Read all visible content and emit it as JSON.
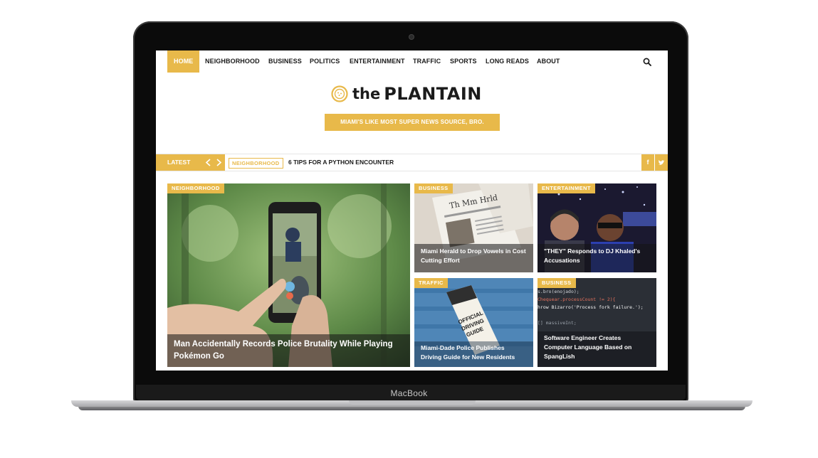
{
  "device": {
    "brand_label": "MacBook"
  },
  "nav": {
    "items": [
      "HOME",
      "NEIGHBORHOOD",
      "BUSINESS",
      "POLITICS",
      "ENTERTAINMENT",
      "TRAFFIC",
      "SPORTS",
      "LONG READS",
      "ABOUT"
    ],
    "active": "HOME",
    "search_icon": "search-icon"
  },
  "masthead": {
    "logo_prefix": "the",
    "logo_name": "PLANTAIN",
    "tagline": "MIAMI'S LIKE MOST SUPER NEWS SOURCE, BRO."
  },
  "ticker": {
    "label": "LATEST",
    "category": "NEIGHBORHOOD",
    "headline": "6 TIPS FOR A PYTHON ENCOUNTER",
    "social": [
      "f",
      "twitter-icon"
    ]
  },
  "articles": [
    {
      "category": "NEIGHBORHOOD",
      "title": "Man Accidentally Records Police Brutality While Playing Pokémon Go"
    },
    {
      "category": "BUSINESS",
      "title": "Miami Herald to Drop Vowels in Cost Cutting Effort"
    },
    {
      "category": "ENTERTAINMENT",
      "title": "\"THEY\" Responds to DJ Khaled's Accusations"
    },
    {
      "category": "TRAFFIC",
      "title": "Miami-Dade Police Publishes Driving Guide for New Residents"
    },
    {
      "category": "BUSINESS",
      "title": "Software Engineer Creates Computer Language Based on SpangLish"
    }
  ],
  "image_text": {
    "newspaper_masthead": "Th Mm Hrld",
    "guide_line1": "OFFICIAL",
    "guide_line2": "DRIVING",
    "guide_line3": "GUIDE",
    "code_lines": [
      "s.bro(enojado);",
      "Chequear.processCount != 2){",
      "hrow Bizarro('Process fork failure.');",
      "[] massiveInt;"
    ]
  },
  "colors": {
    "accent": "#e8b94a",
    "text": "#1b1b1b"
  }
}
